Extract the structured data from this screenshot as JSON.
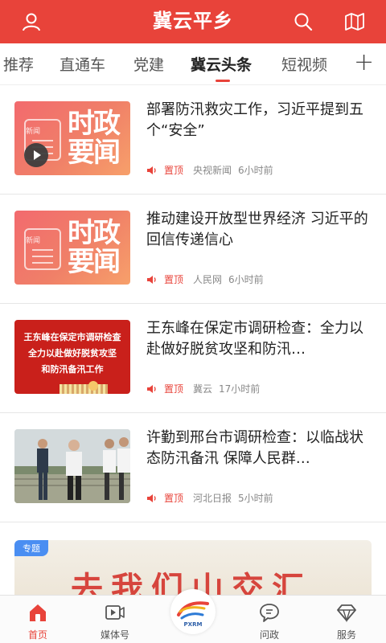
{
  "header": {
    "title": "冀云平乡"
  },
  "tabs": [
    "推荐",
    "直通车",
    "党建",
    "冀云头条",
    "短视频"
  ],
  "tab_add": "+",
  "news": [
    {
      "title": "部署防汛救灾工作，习近平提到五个“安全”",
      "top": "置顶",
      "source": "央视新闻",
      "time": "6小时前",
      "thumb": {
        "label": "新闻",
        "line1": "时政",
        "line2": "要闻",
        "video": true
      }
    },
    {
      "title": "推动建设开放型世界经济 习近平的回信传递信心",
      "top": "置顶",
      "source": "人民网",
      "time": "6小时前",
      "thumb": {
        "label": "新闻",
        "line1": "时政",
        "line2": "要闻",
        "video": false
      }
    },
    {
      "title": "王东峰在保定市调研检查：全力以赴做好脱贫攻坚和防汛…",
      "top": "置顶",
      "source": "冀云",
      "time": "17小时前",
      "thumb": {
        "lines": [
          "王东峰在保定市调研检查",
          "全力以赴做好脱贫攻坚",
          "和防汛备汛工作"
        ]
      }
    },
    {
      "title": "许勤到邢台市调研检查：以临战状态防汛备汛 保障人民群…",
      "top": "置顶",
      "source": "河北日报",
      "time": "5小时前"
    }
  ],
  "special": {
    "badge": "专题",
    "text": "去我们山交汇"
  },
  "bottom_nav": [
    {
      "label": "首页",
      "icon": "home-icon",
      "active": true
    },
    {
      "label": "媒体号",
      "icon": "video-icon",
      "active": false
    },
    {
      "label": "",
      "icon": "pxrm-logo",
      "logo_text": "PXRM"
    },
    {
      "label": "问政",
      "icon": "chat-icon",
      "active": false
    },
    {
      "label": "服务",
      "icon": "diamond-icon",
      "active": false
    }
  ],
  "colors": {
    "accent": "#e8433a",
    "header_bg": "#e8433a",
    "badge": "#4a8ef2"
  }
}
